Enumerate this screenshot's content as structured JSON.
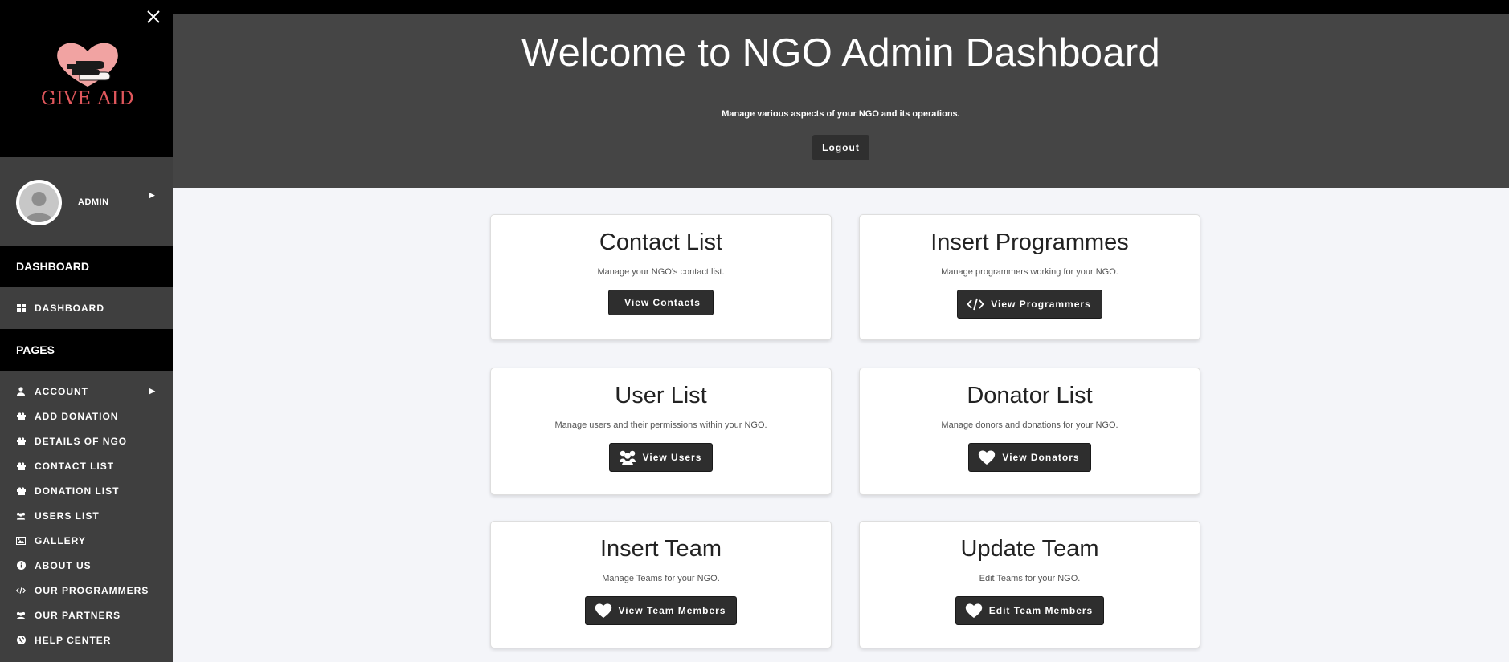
{
  "brand": {
    "logo_text": "GIVE AID"
  },
  "user": {
    "name": "ADMIN"
  },
  "sidebar": {
    "section_dashboard": "DASHBOARD",
    "dashboard_item": "DASHBOARD",
    "section_pages": "PAGES",
    "items": [
      {
        "label": "ACCOUNT",
        "icon": "user-icon"
      },
      {
        "label": "ADD DONATION",
        "icon": "gift-icon"
      },
      {
        "label": "DETAILS OF NGO",
        "icon": "gift-icon"
      },
      {
        "label": "CONTACT LIST",
        "icon": "gift-icon"
      },
      {
        "label": "DONATION LIST",
        "icon": "gift-icon"
      },
      {
        "label": "USERS LIST",
        "icon": "users-icon"
      },
      {
        "label": "GALLERY",
        "icon": "image-icon"
      },
      {
        "label": "ABOUT US",
        "icon": "info-icon"
      },
      {
        "label": "OUR PROGRAMMERS",
        "icon": "code-icon"
      },
      {
        "label": "OUR PARTNERS",
        "icon": "users-icon"
      },
      {
        "label": "HELP CENTER",
        "icon": "globe-icon"
      }
    ]
  },
  "header": {
    "title": "Welcome to NGO Admin Dashboard",
    "subtitle": "Manage various aspects of your NGO and its operations.",
    "logout_label": "Logout"
  },
  "cards": [
    {
      "title": "Contact List",
      "desc": "Manage your NGO's contact list.",
      "button": "View Contacts",
      "icon": "none"
    },
    {
      "title": "Insert Programmes",
      "desc": "Manage programmers working for your NGO.",
      "button": "View Programmers",
      "icon": "code-icon"
    },
    {
      "title": "User List",
      "desc": "Manage users and their permissions within your NGO.",
      "button": "View Users",
      "icon": "users-icon"
    },
    {
      "title": "Donator List",
      "desc": "Manage donors and donations for your NGO.",
      "button": "View Donators",
      "icon": "heart-icon"
    },
    {
      "title": "Insert Team",
      "desc": "Manage Teams for your NGO.",
      "button": "View Team Members",
      "icon": "heart-icon"
    },
    {
      "title": "Update Team",
      "desc": "Edit Teams for your NGO.",
      "button": "Edit Team Members",
      "icon": "heart-icon"
    }
  ],
  "colors": {
    "sidebar_bg": "#3f3f3f",
    "header_bg": "#454545",
    "accent": "#e0575c",
    "button_bg": "#2e2e2e"
  }
}
